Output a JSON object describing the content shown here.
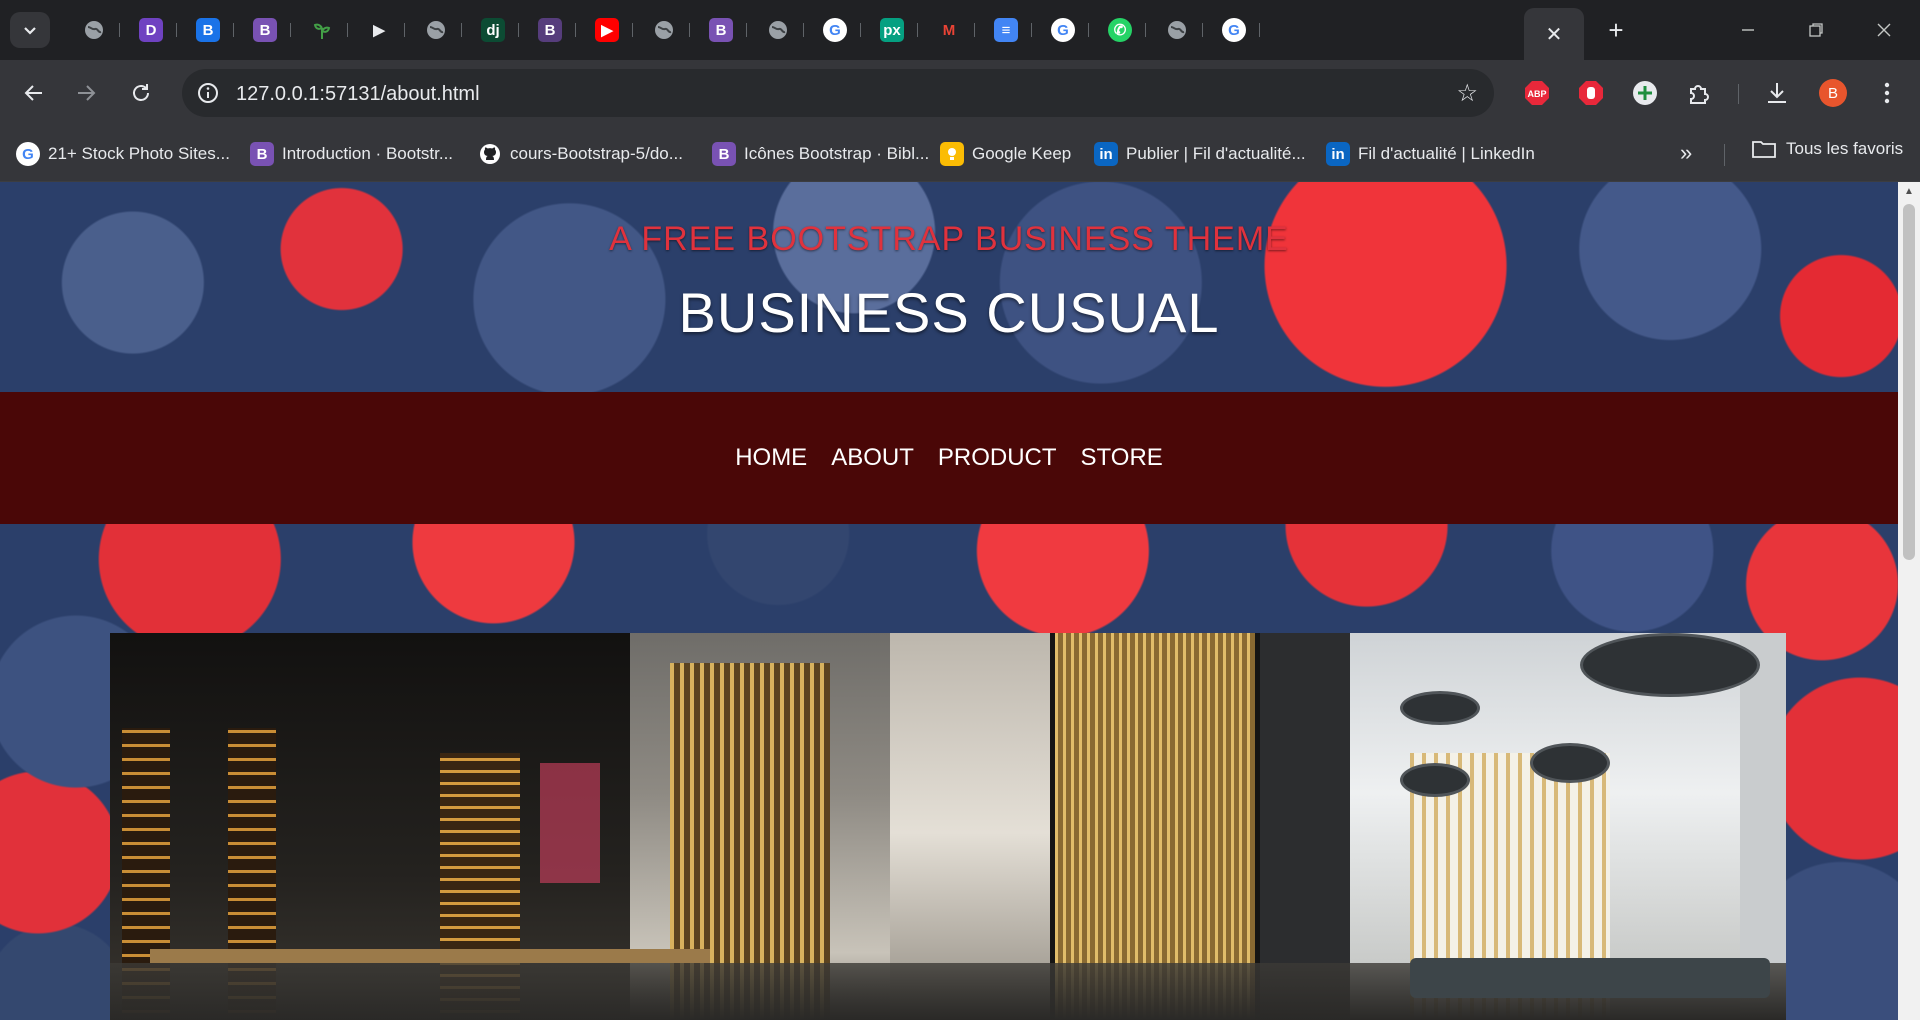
{
  "browser": {
    "tabs": [
      {
        "icon": "globe-icon",
        "letter": "",
        "color": "#5f6368"
      },
      {
        "icon": "d-app-icon",
        "letter": "D",
        "color": "#6f42c1"
      },
      {
        "icon": "bootstrap-icon",
        "letter": "B",
        "color": "#1a73e8"
      },
      {
        "icon": "bootstrap-icon",
        "letter": "B",
        "color": "#7952b3"
      },
      {
        "icon": "plant-icon",
        "letter": "",
        "color": "#2e7d32"
      },
      {
        "icon": "play-icon",
        "letter": "▶",
        "color": "#202124"
      },
      {
        "icon": "globe-icon",
        "letter": "",
        "color": "#5f6368"
      },
      {
        "icon": "django-icon",
        "letter": "dj",
        "color": "#0c4b33"
      },
      {
        "icon": "bootstrap-icon",
        "letter": "B",
        "color": "#563d7c"
      },
      {
        "icon": "youtube-icon",
        "letter": "▶",
        "color": "#ff0000"
      },
      {
        "icon": "globe-icon",
        "letter": "",
        "color": "#5f6368"
      },
      {
        "icon": "bootstrap-icon",
        "letter": "B",
        "color": "#7952b3"
      },
      {
        "icon": "globe-icon",
        "letter": "",
        "color": "#5f6368"
      },
      {
        "icon": "google-icon",
        "letter": "G",
        "color": "#ffffff"
      },
      {
        "icon": "pexels-icon",
        "letter": "px",
        "color": "#05a081"
      },
      {
        "icon": "gmail-icon",
        "letter": "M",
        "color": "#ffffff"
      },
      {
        "icon": "docs-icon",
        "letter": "≡",
        "color": "#4285f4"
      },
      {
        "icon": "google-icon",
        "letter": "G",
        "color": "#ffffff"
      },
      {
        "icon": "whatsapp-icon",
        "letter": "✆",
        "color": "#25d366"
      },
      {
        "icon": "globe-icon",
        "letter": "",
        "color": "#5f6368"
      },
      {
        "icon": "google-icon",
        "letter": "G",
        "color": "#ffffff"
      }
    ],
    "active_tab_close": "✕",
    "new_tab": "+",
    "url": "127.0.0.1:57131/about.html",
    "profile_letter": "B",
    "bookmarks": [
      {
        "label": "21+ Stock Photo Sites...",
        "icon": "google-icon",
        "letter": "G",
        "color": "#ffffff"
      },
      {
        "label": "Introduction · Bootstr...",
        "icon": "bootstrap-icon",
        "letter": "B",
        "color": "#7952b3"
      },
      {
        "label": "cours-Bootstrap-5/do...",
        "icon": "github-icon",
        "letter": "",
        "color": "#ffffff"
      },
      {
        "label": "Icônes Bootstrap · Bibl...",
        "icon": "bootstrap-icon",
        "letter": "B",
        "color": "#7952b3"
      },
      {
        "label": "Google Keep",
        "icon": "keep-icon",
        "letter": "",
        "color": "#fbbc04"
      },
      {
        "label": "Publier | Fil d'actualité...",
        "icon": "linkedin-icon",
        "letter": "in",
        "color": "#0a66c2"
      },
      {
        "label": "Fil d'actualité | LinkedIn",
        "icon": "linkedin-icon",
        "letter": "in",
        "color": "#0a66c2"
      }
    ],
    "all_bookmarks": "Tous les favoris"
  },
  "page": {
    "heading_upper": "A Free Bootstrap Business Theme",
    "heading_lower": "Business Cusual",
    "nav": [
      "Home",
      "About",
      "Product",
      "Store"
    ],
    "accent_red": "#e0323d",
    "nav_bg": "#4a0707"
  }
}
